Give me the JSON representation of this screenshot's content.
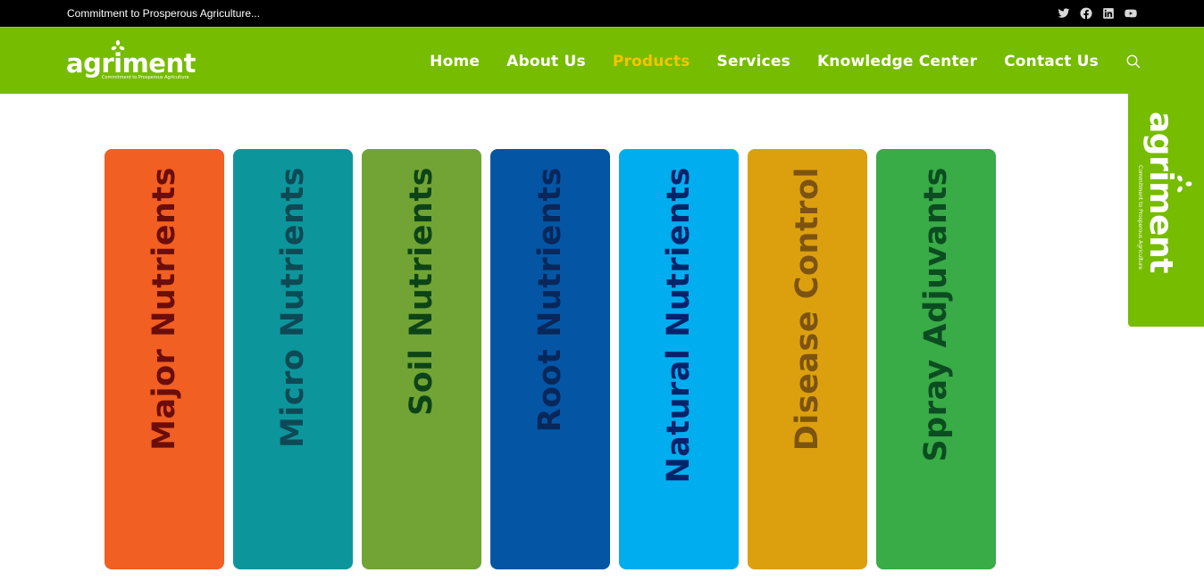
{
  "topbar": {
    "tagline": "Commitment to Prosperous Agriculture...",
    "social": [
      {
        "name": "twitter-icon"
      },
      {
        "name": "facebook-icon"
      },
      {
        "name": "linkedin-icon"
      },
      {
        "name": "youtube-icon"
      }
    ]
  },
  "header": {
    "logo_text": "agriment",
    "logo_subtitle": "Commitment to Prosperous Agriculture",
    "nav": [
      {
        "label": "Home",
        "active": false
      },
      {
        "label": "About Us",
        "active": false
      },
      {
        "label": "Products",
        "active": true
      },
      {
        "label": "Services",
        "active": false
      },
      {
        "label": "Knowledge Center",
        "active": false
      },
      {
        "label": "Contact Us",
        "active": false
      }
    ],
    "search_icon": "search-icon"
  },
  "products": [
    {
      "label": "Major Nutrients",
      "bg": "#f15f22",
      "fg": "#6b0d0a"
    },
    {
      "label": "Micro Nutrients",
      "bg": "#0c969c",
      "fg": "#0d4a56"
    },
    {
      "label": "Soil Nutrients",
      "bg": "#72a435",
      "fg": "#0d4417"
    },
    {
      "label": "Root Nutrients",
      "bg": "#0456a5",
      "fg": "#08275a"
    },
    {
      "label": "Natural Nutrients",
      "bg": "#00aeef",
      "fg": "#04236b"
    },
    {
      "label": "Disease Control",
      "bg": "#dca00f",
      "fg": "#7c5310"
    },
    {
      "label": "Spray Adjuvants",
      "bg": "#39ab47",
      "fg": "#0b4d21"
    }
  ],
  "side_badge": {
    "logo_text": "agriment",
    "logo_subtitle": "Commitment to Prosperous Agriculture"
  },
  "colors": {
    "brand_green": "#76bc00",
    "active_nav": "#f6c400",
    "topbar": "#000000"
  }
}
